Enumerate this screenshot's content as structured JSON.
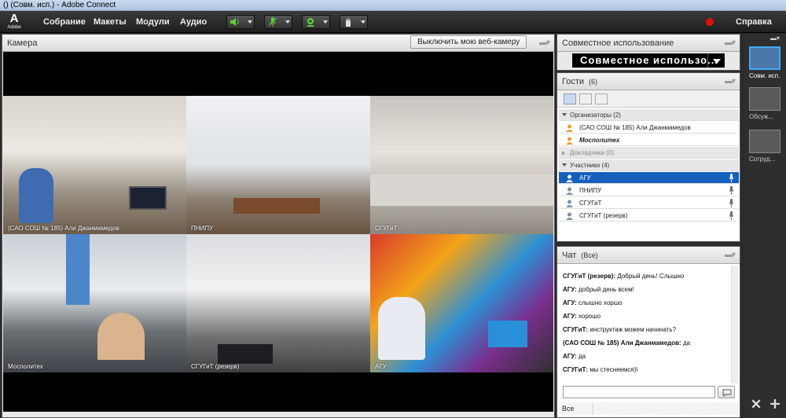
{
  "window": {
    "title": "() (Совм. исп.) - Adobe Connect"
  },
  "logo": {
    "letter": "A",
    "text": "Adobe"
  },
  "menu": {
    "items": [
      "Собрание",
      "Макеты",
      "Модули",
      "Аудио"
    ]
  },
  "help": "Справка",
  "camera_pod": {
    "title": "Камера",
    "button": "Выключить мою веб-камеру",
    "tiles": [
      {
        "label": "(САО СОШ № 185) Али Джанмамедов"
      },
      {
        "label": "ПНИПУ"
      },
      {
        "label": "СГУГиТ"
      },
      {
        "label": "Мосполитех"
      },
      {
        "label": "СГУГиТ (резерв)"
      },
      {
        "label": "АГУ"
      }
    ]
  },
  "share_pod": {
    "title": "Совместное использование",
    "button": "Совместное использо..."
  },
  "guests_pod": {
    "title": "Гости",
    "count": "(6)",
    "groups": [
      {
        "label": "Организаторы (2)",
        "members": [
          "(САО СОШ № 185) Али Джанмамедов",
          "Мосполитех"
        ]
      },
      {
        "label": "Докладчики (0)",
        "members": []
      },
      {
        "label": "Участники (4)",
        "members": [
          "АГУ",
          "ПНИПУ",
          "СГУГиТ",
          "СГУГиТ (резерв)"
        ]
      }
    ]
  },
  "chat_pod": {
    "title": "Чат",
    "scope": "(Все)",
    "messages": [
      {
        "from": "СГУГиТ (резерв):",
        "text": "Добрый день! Слышно"
      },
      {
        "from": "АГУ:",
        "text": "добрый день всем!"
      },
      {
        "from": "АГУ:",
        "text": "слышно хоршо"
      },
      {
        "from": "АГУ:",
        "text": "хорошо"
      },
      {
        "from": "СГУГиТ:",
        "text": "инструктаж можем начинать?"
      },
      {
        "from": "(САО СОШ № 185) Али Джанмамедов:",
        "text": "да"
      },
      {
        "from": "АГУ:",
        "text": "да"
      },
      {
        "from": "СГУГиТ:",
        "text": "мы стесняемся)\\"
      }
    ],
    "input_value": "",
    "recipient": "Все"
  },
  "layouts": [
    {
      "label": "Совм. исп."
    },
    {
      "label": "Обсуж..."
    },
    {
      "label": "Сотруд..."
    }
  ]
}
